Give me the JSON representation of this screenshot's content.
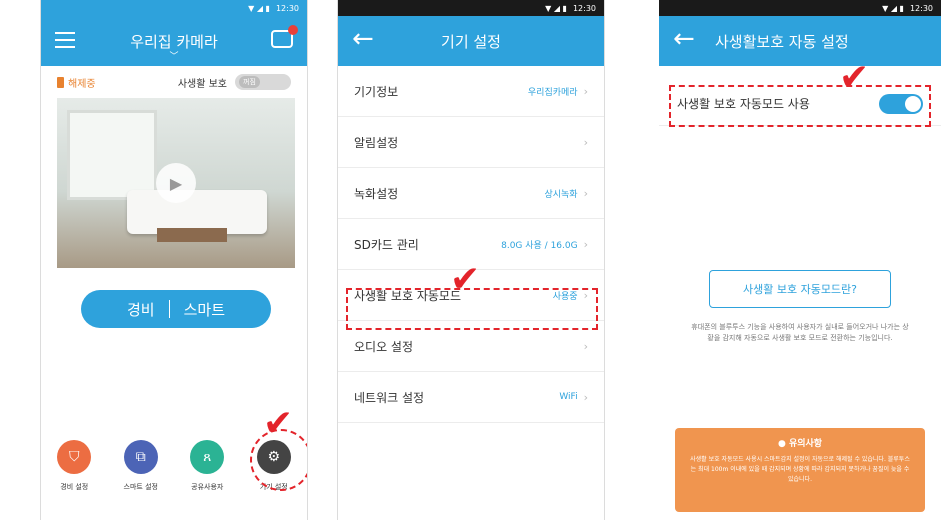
{
  "status_bar": {
    "time": "12:30"
  },
  "screen1": {
    "title": "우리집 카메라",
    "guard_status": "해제중",
    "privacy_label": "사생활 보호",
    "privacy_toggle_state": "꺼짐",
    "mode_left": "경비",
    "mode_right": "스마트",
    "dock": [
      {
        "label": "경비 설정",
        "icon": "shield-icon"
      },
      {
        "label": "스마트 설정",
        "icon": "smart-icon"
      },
      {
        "label": "공유사용자",
        "icon": "users-icon"
      },
      {
        "label": "기기 설정",
        "icon": "gear-icon"
      }
    ]
  },
  "screen2": {
    "title": "기기 설정",
    "items": [
      {
        "label": "기기정보",
        "value": "우리집카메라"
      },
      {
        "label": "알림설정",
        "value": ""
      },
      {
        "label": "녹화설정",
        "value": "상시녹화"
      },
      {
        "label": "SD카드 관리",
        "value": "8.0G 사용 / 16.0G"
      },
      {
        "label": "사생활 보호 자동모드",
        "value": "사용중"
      },
      {
        "label": "오디오 설정",
        "value": ""
      },
      {
        "label": "네트워크 설정",
        "value": "WiFi"
      }
    ]
  },
  "screen3": {
    "title": "사생활보호 자동 설정",
    "auto_label": "사생활 보호 자동모드 사용",
    "info_button": "사생활 보호 자동모드란?",
    "info_text": "휴대폰의 블루투스 기능을 사용하여 사용자가 실내로 들어오거나 나가는 상황을 감지해 자동으로 사생활 보호 모드로 전환하는 기능입니다.",
    "notice_title": "유의사항",
    "notice_body": "사생활 보호 자동모드 사용시 스마트감지 설정이 자동으로 해제될 수 있습니다. 블루투스는 최대 100m 이내에 있을 때 감지되며 상황에 따라 감지되지 못하거나 꿈질이 늦을 수 있습니다."
  },
  "colors": {
    "accent": "#2ea2dc",
    "highlight": "#e3242b",
    "warning": "#f0954f"
  }
}
